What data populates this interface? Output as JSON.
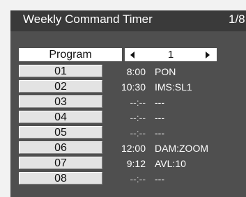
{
  "header": {
    "title": "Weekly Command Timer",
    "page": "1/8"
  },
  "program": {
    "label": "Program",
    "value": "1"
  },
  "entries": [
    {
      "number": "01",
      "time": "8:00",
      "command": "PON"
    },
    {
      "number": "02",
      "time": "10:30",
      "command": "IMS:SL1"
    },
    {
      "number": "03",
      "time": "--:--",
      "command": "---"
    },
    {
      "number": "04",
      "time": "--:--",
      "command": "---"
    },
    {
      "number": "05",
      "time": "--:--",
      "command": "---"
    },
    {
      "number": "06",
      "time": "12:00",
      "command": "DAM:ZOOM"
    },
    {
      "number": "07",
      "time": "9:12",
      "command": "AVL:10"
    },
    {
      "number": "08",
      "time": "--:--",
      "command": "---"
    }
  ],
  "icons": {
    "prev": "triangle-left-icon",
    "next": "triangle-right-icon"
  },
  "colors": {
    "panel": "#4f4f4f",
    "header": "#3a3a3a",
    "button": "#e3e3e3"
  }
}
